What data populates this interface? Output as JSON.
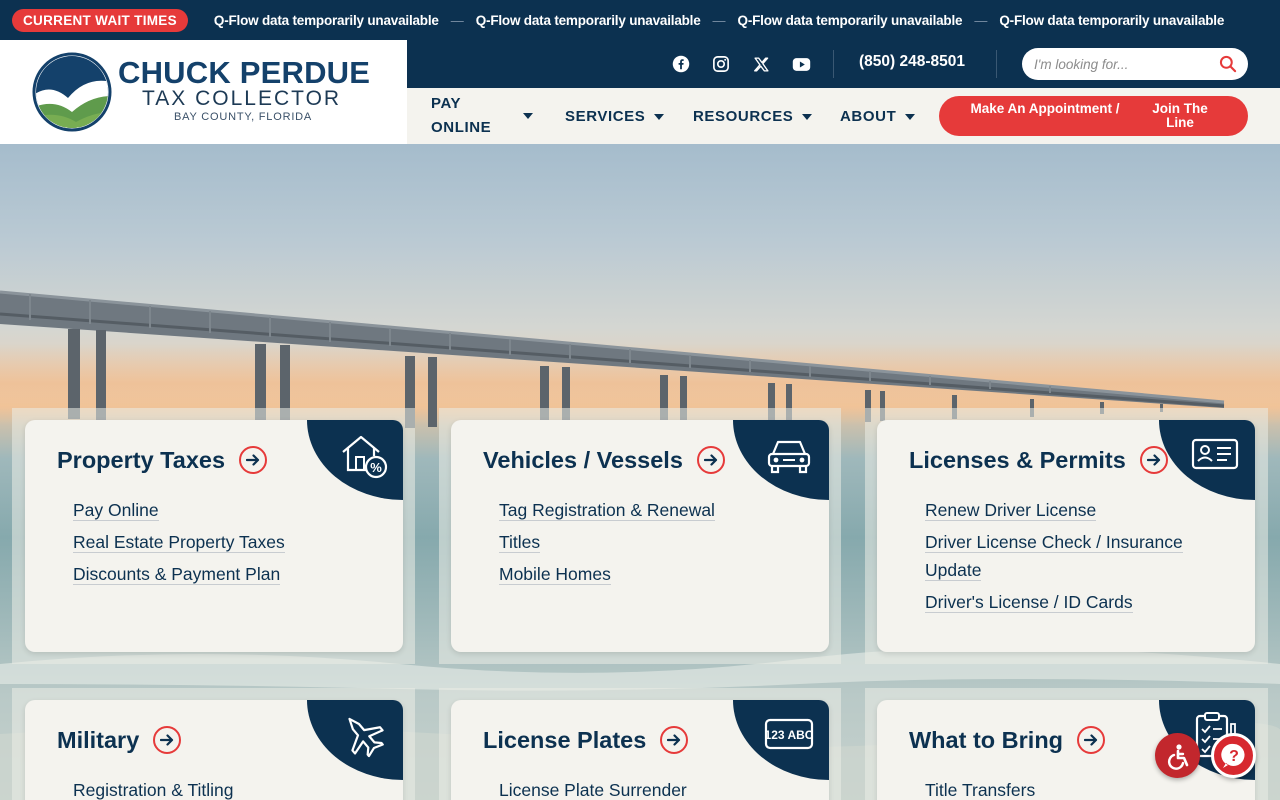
{
  "ticker": {
    "badge": "CURRENT WAIT TIMES",
    "messages": [
      "Q-Flow data temporarily unavailable",
      "Q-Flow data temporarily unavailable",
      "Q-Flow data temporarily unavailable",
      "Q-Flow data temporarily unavailable"
    ],
    "separator": "—"
  },
  "logo": {
    "name": "CHUCK PERDUE",
    "subtitle": "TAX COLLECTOR",
    "county": "BAY COUNTY, FLORIDA"
  },
  "utility": {
    "social_icons": [
      "facebook-icon",
      "instagram-icon",
      "x-icon",
      "youtube-icon"
    ],
    "phone": "(850) 248-8501",
    "search_placeholder": "I'm looking for..."
  },
  "nav": {
    "pay_line1": "PAY",
    "pay_line2": "ONLINE",
    "services": "SERVICES",
    "resources": "RESOURCES",
    "about": "ABOUT",
    "appointment": "Make An Appointment /",
    "join_line": "Join The Line"
  },
  "cards": [
    {
      "title": "Property Taxes",
      "icon": "house-percent-icon",
      "links": [
        "Pay Online",
        "Real Estate Property Taxes",
        "Discounts & Payment Plan"
      ]
    },
    {
      "title": "Vehicles / Vessels",
      "icon": "car-icon",
      "links": [
        "Tag Registration & Renewal",
        "Titles",
        "Mobile Homes"
      ]
    },
    {
      "title": "Licenses & Permits",
      "icon": "id-card-icon",
      "links": [
        "Renew Driver License",
        "Driver License Check / Insurance Update",
        "Driver's License / ID Cards"
      ]
    },
    {
      "title": "Military",
      "icon": "jet-icon",
      "links": [
        "Registration & Titling"
      ]
    },
    {
      "title": "License Plates",
      "icon": "license-plate-icon",
      "plate_text": "123 ABC",
      "links": [
        "License Plate Surrender"
      ]
    },
    {
      "title": "What to Bring",
      "icon": "clipboard-checklist-icon",
      "links": [
        "Title Transfers"
      ]
    }
  ],
  "colors": {
    "navy": "#0c3150",
    "accent_red": "#e63a3a",
    "card_bg": "#f4f3ee"
  }
}
